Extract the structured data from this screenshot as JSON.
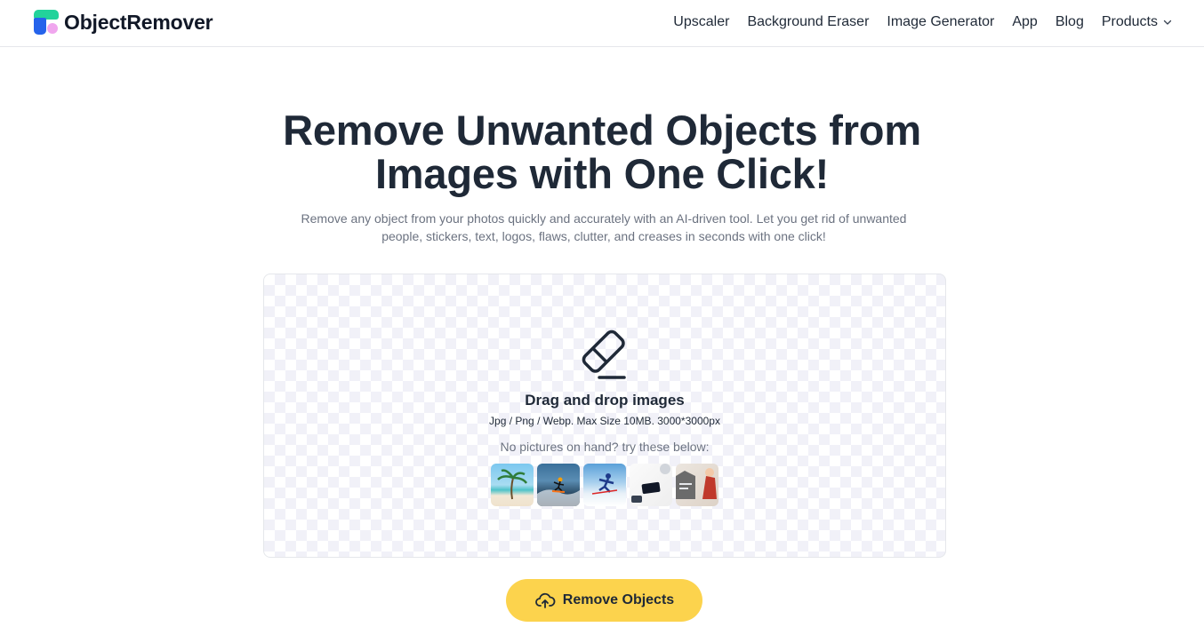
{
  "header": {
    "brand": "ObjectRemover",
    "nav": [
      {
        "label": "Upscaler"
      },
      {
        "label": "Background Eraser"
      },
      {
        "label": "Image Generator"
      },
      {
        "label": "App"
      },
      {
        "label": "Blog"
      },
      {
        "label": "Products"
      }
    ]
  },
  "hero": {
    "title_line1": "Remove Unwanted Objects from",
    "title_line2": "Images with One Click!",
    "subtitle_line1": "Remove any object from your photos quickly and accurately with an AI-driven tool. Let you get rid of unwanted",
    "subtitle_line2": "people, stickers, text, logos, flaws, clutter, and creases in seconds with one click!"
  },
  "upload": {
    "title": "Drag and drop images",
    "spec": "Jpg / Png / Webp. Max Size 10MB. 3000*3000px",
    "try_text": "No pictures on hand? try these below:",
    "samples": [
      "beach-palm",
      "surfer",
      "skier",
      "desk-phone",
      "person-poster"
    ]
  },
  "cta": {
    "label": "Remove Objects",
    "color": "#fcd34d"
  },
  "colors": {
    "brand_green": "#22d39b",
    "brand_blue": "#2563eb",
    "brand_pink": "#f0a6ee",
    "text_dark": "#1f2937",
    "text_muted": "#6b7280"
  }
}
